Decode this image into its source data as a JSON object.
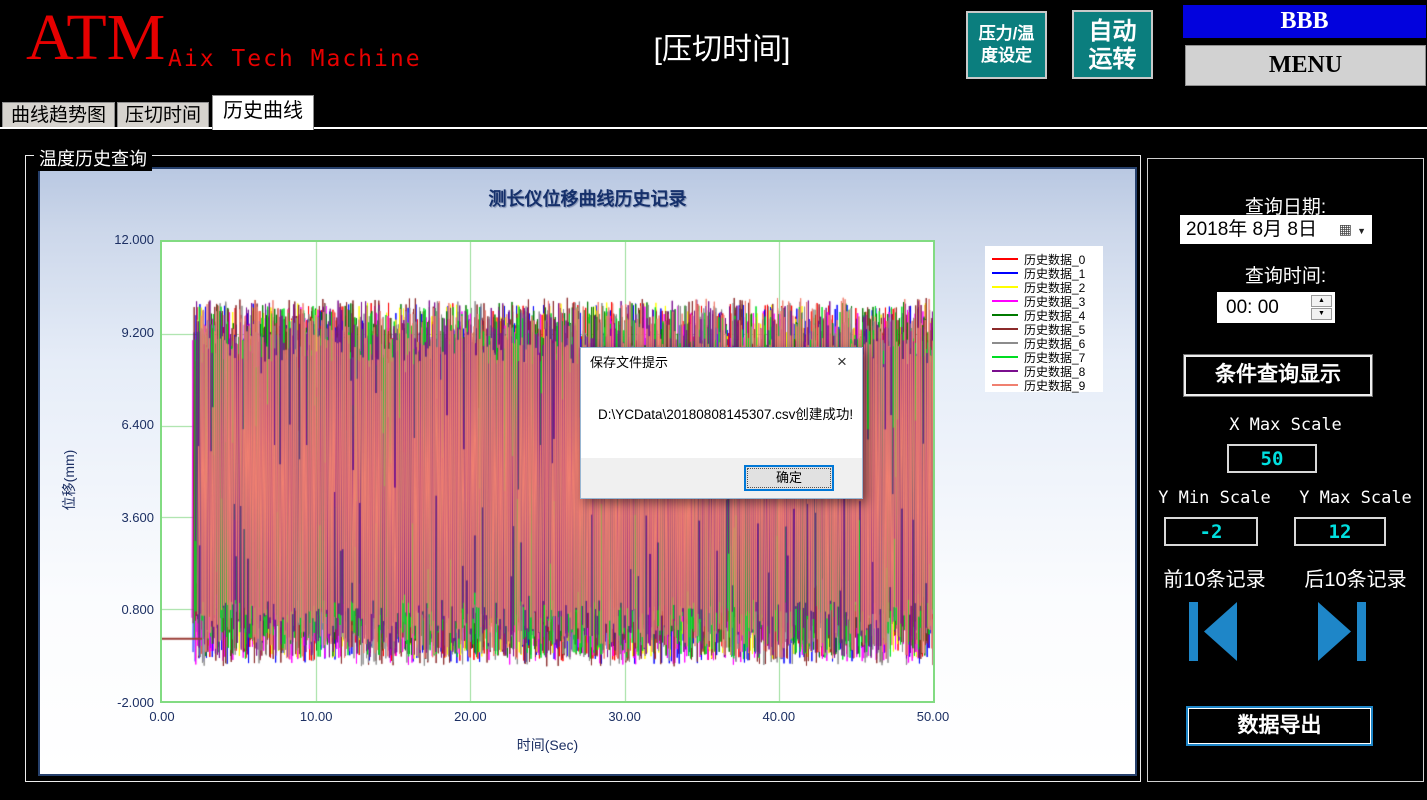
{
  "header": {
    "logo_main": "ATM",
    "logo_sub": "Aix Tech Machine",
    "page_title": "[压切时间]",
    "pressure_temp_button": {
      "line1": "压力/温",
      "line2": "度设定"
    },
    "auto_run_button": {
      "line1": "自动",
      "line2": "运转"
    },
    "bbb_label": "BBB",
    "menu_label": "MENU"
  },
  "tabs": [
    {
      "label": "曲线趋势图",
      "selected": false
    },
    {
      "label": "压切时间",
      "selected": false
    },
    {
      "label": "历史曲线",
      "selected": true
    }
  ],
  "group_box": {
    "title": "温度历史查询"
  },
  "chart_data": {
    "type": "line",
    "title": "测长仪位移曲线历史记录",
    "xlabel": "时间(Sec)",
    "ylabel": "位移(mm)",
    "xlim": [
      0,
      50
    ],
    "ylim": [
      -2,
      12
    ],
    "x_ticks": [
      "0.00",
      "10.00",
      "20.00",
      "30.00",
      "40.00",
      "50.00"
    ],
    "y_ticks": [
      "12.000",
      "9.200",
      "6.400",
      "3.600",
      "0.800",
      "-2.000"
    ],
    "grid": true,
    "grid_color": "#97dd97",
    "plot_border_color": "#82db82",
    "plot_background": "#ffffff",
    "legend_position": "top-right",
    "series": [
      {
        "name": "历史数据_0",
        "color": "#ff0000",
        "seed": 11
      },
      {
        "name": "历史数据_1",
        "color": "#0000ff",
        "seed": 22
      },
      {
        "name": "历史数据_2",
        "color": "#ffff00",
        "seed": 33
      },
      {
        "name": "历史数据_3",
        "color": "#ff00ff",
        "seed": 44
      },
      {
        "name": "历史数据_4",
        "color": "#007a00",
        "seed": 55
      },
      {
        "name": "历史数据_5",
        "color": "#8b2a2a",
        "seed": 66
      },
      {
        "name": "历史数据_6",
        "color": "#8c8c8c",
        "seed": 77
      },
      {
        "name": "历史数据_7",
        "color": "#00dd22",
        "seed": 88
      },
      {
        "name": "历史数据_8",
        "color": "#7a0f8e",
        "seed": 99
      },
      {
        "name": "历史数据_9",
        "color": "#f08070",
        "seed": 110
      }
    ],
    "noise": {
      "x_start": 1.9,
      "x_end": 50,
      "y_min": -0.95,
      "y_max": 10.35,
      "note": "ten overlapping dense pseudo-random displacement traces oscillating between about -1 and 10.4 mm from t=2s to t=50s; individual sample values are not resolvable from the screenshot"
    },
    "flat_segment": {
      "color": "#9a3c34",
      "y": -0.1,
      "x_start": 0,
      "x_end": 2.6
    }
  },
  "dialog": {
    "title": "保存文件提示",
    "close_glyph": "×",
    "message": "D:\\YCData\\20180808145307.csv创建成功!",
    "ok_label": "确定"
  },
  "right_panel": {
    "date_label": "查询日期:",
    "date_value": "2018年 8月 8日",
    "time_label": "查询时间:",
    "time_value": "00: 00",
    "query_button": "条件查询显示",
    "x_max_label": "X Max Scale",
    "x_max_value": "50",
    "y_min_label": "Y Min Scale",
    "y_min_value": "-2",
    "y_max_label": "Y Max Scale",
    "y_max_value": "12",
    "prev_label": "前10条记录",
    "next_label": "后10条记录",
    "export_button": "数据导出"
  },
  "icons": {
    "calendar_glyph": "▦",
    "dropdown_glyph": "▼",
    "spin_up_glyph": "▲",
    "spin_down_glyph": "▼"
  },
  "colors": {
    "teal": "#0b7e7e",
    "bbb_blue": "#0202dd",
    "arrow_blue": "#1e86c8",
    "value_cyan": "#00dfdf",
    "logo_red": "#e60000",
    "chart_border": "#26406c",
    "plot_border": "#82db82",
    "axis_text": "#1c2f63",
    "ok_border": "#0078d7"
  }
}
